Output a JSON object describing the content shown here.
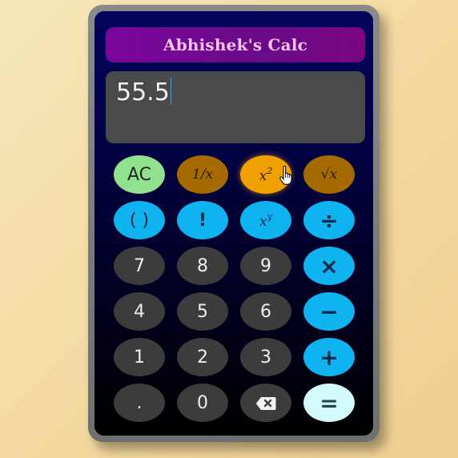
{
  "title": "Abhishek's Calc",
  "display": {
    "value": "55.5"
  },
  "keys": {
    "row1": [
      {
        "label": "AC",
        "name": "all-clear-button"
      },
      {
        "label": "1/x",
        "name": "reciprocal-button"
      },
      {
        "label": "x",
        "sup": "2",
        "name": "square-button"
      },
      {
        "label": "√x",
        "name": "sqrt-button"
      }
    ],
    "row2": [
      {
        "label": "( )",
        "name": "parentheses-button"
      },
      {
        "label": "!",
        "name": "factorial-button"
      },
      {
        "label": "x",
        "sup": "y",
        "name": "power-button"
      },
      {
        "label": "÷",
        "name": "divide-button"
      }
    ],
    "row3": [
      {
        "label": "7"
      },
      {
        "label": "8"
      },
      {
        "label": "9"
      },
      {
        "label": "×",
        "name": "multiply-button"
      }
    ],
    "row4": [
      {
        "label": "4"
      },
      {
        "label": "5"
      },
      {
        "label": "6"
      },
      {
        "label": "−",
        "name": "subtract-button"
      }
    ],
    "row5": [
      {
        "label": "1"
      },
      {
        "label": "2"
      },
      {
        "label": "3"
      },
      {
        "label": "+",
        "name": "add-button"
      }
    ],
    "row6": [
      {
        "label": "."
      },
      {
        "label": "0"
      },
      {
        "label": "⌫",
        "icon": "backspace-icon"
      },
      {
        "label": "=",
        "name": "equals-button"
      }
    ]
  },
  "colors": {
    "number_key": "#3c3c3c",
    "operator_key": "#0fb3f0",
    "function_key": "#a56a00",
    "function_key_active": "#f0a000",
    "clear_key": "#92e18e",
    "equals_key": "#d4fbfb",
    "title_bar": "#7a069b"
  },
  "icons": {
    "cursor": "hand-pointer-icon",
    "backspace": "backspace-icon"
  }
}
